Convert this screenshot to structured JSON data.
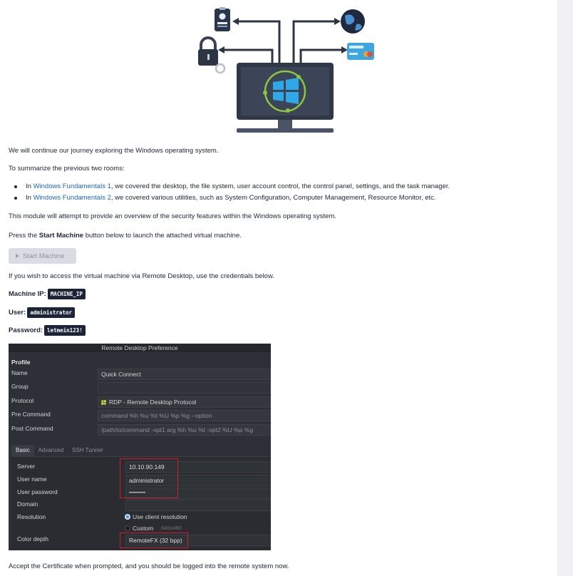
{
  "intro": "We will continue our journey exploring the Windows operating system.",
  "summary": "To summarize the previous two rooms:",
  "bullets": [
    {
      "prefix": "In ",
      "link": "Windows Fundamentals 1",
      "rest": ", we covered the desktop, the file system, user account control, the control panel, settings, and the task manager."
    },
    {
      "prefix": "In ",
      "link": "Windows Fundamentals 2",
      "rest": ", we covered various utilities, such as System Configuration, Computer Management, Resource Monitor, etc."
    }
  ],
  "overview": "This module will attempt to provide an overview of the security features within the Windows operating system.",
  "press": {
    "before": "Press the ",
    "bold": "Start Machine",
    "after": " button below to launch the attached virtual machine."
  },
  "start_button": "Start Machine",
  "rdp_hint": "If you wish to access the virtual machine via Remote Desktop, use the credentials below.",
  "credentials": {
    "ip_label": "Machine IP:",
    "ip_value": "MACHINE_IP",
    "user_label": "User:",
    "user_value": "administrator",
    "password_label": "Password:",
    "password_value": "letmein123!"
  },
  "rdp_dialog": {
    "title": "Remote Desktop Preference",
    "profile": "Profile",
    "name_label": "Name",
    "name_value": "Quick Connect",
    "group_label": "Group",
    "protocol_label": "Protocol",
    "protocol_value": "RDP - Remote Desktop Protocol",
    "precommand_label": "Pre Command",
    "precommand_value": "command %h %u %t %U %p %g --option",
    "postcommand_label": "Post Command",
    "postcommand_value": "/path/to/command -opt1 arg %h %u %t -opt2 %U %p %g",
    "tabs": [
      "Basic",
      "Advanced",
      "SSH Tunnel"
    ],
    "server_label": "Server",
    "server_value": "10.10.90.149",
    "username_label": "User name",
    "username_value": "administrator",
    "password_label": "User password",
    "password_value": "•••••••••••",
    "domain_label": "Domain",
    "resolution_label": "Resolution",
    "resolution_option1": "Use client resolution",
    "resolution_option2": "Custom",
    "resolution_custom_value": "640x480",
    "colordepth_label": "Color depth",
    "colordepth_value": "RemoteFX (32 bpp)"
  },
  "accept": "Accept the Certificate when prompted, and you should be logged into the remote system now.",
  "colors": {
    "accent": "#1e63c9",
    "dark": "#1c2538",
    "highlight": "#d11e28"
  }
}
